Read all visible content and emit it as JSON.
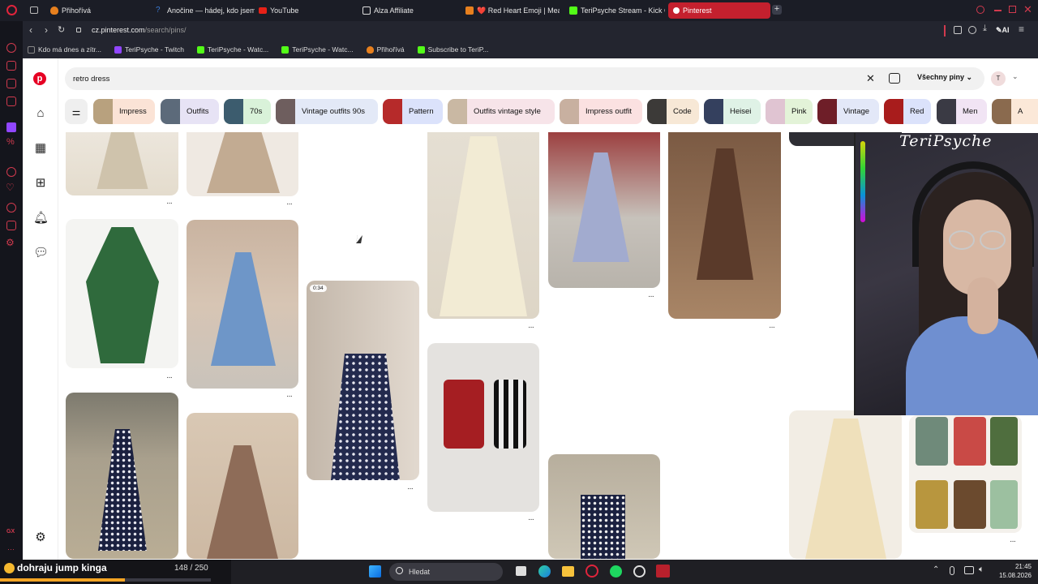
{
  "browser": {
    "tabs": [
      {
        "label": "Přihořívá",
        "color": "#e7801e"
      },
      {
        "label": "Anočine — hádej, kdo jsem",
        "color": "#3a7bd5"
      },
      {
        "label": "YouTube",
        "color": "#e62117"
      },
      {
        "label": "Alza Affiliate",
        "color": "#dddddd"
      },
      {
        "label": "❤️ Red Heart Emoji | Mean...",
        "color": "#e7801e"
      },
      {
        "label": "TeriPsyche Stream - Kick C...",
        "color": "#53fc18"
      },
      {
        "label": "Pinterest",
        "color": "#ffffff"
      }
    ],
    "url_host": "cz.pinterest.com",
    "url_path": "/search/pins/",
    "bookmarks": [
      {
        "label": "Kdo má dnes a zítr...",
        "color": "#888888"
      },
      {
        "label": "TeriPsyche - Twitch",
        "color": "#9146ff"
      },
      {
        "label": "TeriPsyche - Watc...",
        "color": "#53fc18"
      },
      {
        "label": "TeriPsyche - Watc...",
        "color": "#53fc18"
      },
      {
        "label": "Přihořívá",
        "color": "#e7801e"
      },
      {
        "label": "Subscribe to TeriP...",
        "color": "#53fc18"
      }
    ],
    "ai_label": "AI"
  },
  "pinterest": {
    "search_value": "retro dress",
    "filter_label": "Všechny piny",
    "avatar_letter": "T",
    "chips": [
      {
        "label": "Impress",
        "bg": "#fbe3d6"
      },
      {
        "label": "Outfits",
        "bg": "#e7e3f5"
      },
      {
        "label": "70s",
        "bg": "#d9f2d9"
      },
      {
        "label": "Vintage outfits 90s",
        "bg": "#e3e9f7"
      },
      {
        "label": "Pattern",
        "bg": "#dbe2fb"
      },
      {
        "label": "Outfits vintage style",
        "bg": "#f7e4e9"
      },
      {
        "label": "Impress outfit",
        "bg": "#fbe1e1"
      },
      {
        "label": "Code",
        "bg": "#f7e8d6"
      },
      {
        "label": "Heisei",
        "bg": "#dff2e6"
      },
      {
        "label": "Pink",
        "bg": "#e3f3d8"
      },
      {
        "label": "Vintage",
        "bg": "#e3e8f8"
      },
      {
        "label": "Red",
        "bg": "#dbe2fb"
      },
      {
        "label": "Men",
        "bg": "#f1e4f4"
      },
      {
        "label": "A",
        "bg": "#fbe8d8"
      }
    ],
    "video_badge": "0:34",
    "more_label": "···"
  },
  "stream": {
    "overlay_name": "TeriPsyche",
    "goal_text": "dohraju jump kinga",
    "goal_count": "148 / 250",
    "goal_progress": 0.592
  },
  "taskbar": {
    "search_placeholder": "Hledat",
    "time": "21:45",
    "date": "15.08.2026"
  }
}
